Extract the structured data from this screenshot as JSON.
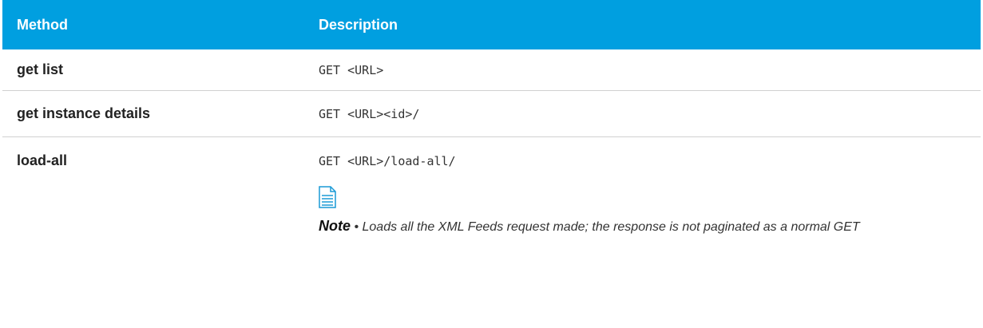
{
  "table": {
    "headers": {
      "method": "Method",
      "description": "Description"
    },
    "rows": [
      {
        "method": "get list",
        "description": "GET <URL>"
      },
      {
        "method": "get instance details",
        "description": "GET <URL><id>/"
      },
      {
        "method": "load-all",
        "description": "GET <URL>/load-all/",
        "note": {
          "icon": "note-document-icon",
          "label": "Note",
          "separator": " • ",
          "text": "Loads all the XML Feeds request made; the response is not paginated as a normal GET"
        }
      }
    ]
  },
  "colors": {
    "header_background": "#009fe0",
    "header_text": "#ffffff",
    "icon_stroke": "#1a9ad6"
  }
}
